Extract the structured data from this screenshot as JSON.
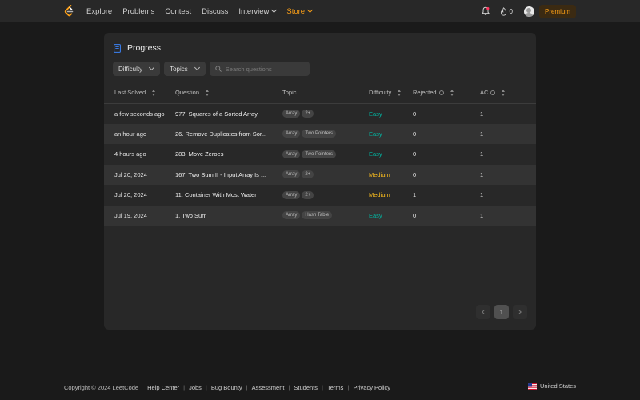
{
  "nav": {
    "items": [
      {
        "label": "Explore",
        "dropdown": false
      },
      {
        "label": "Problems",
        "dropdown": false
      },
      {
        "label": "Contest",
        "dropdown": false
      },
      {
        "label": "Discuss",
        "dropdown": false
      },
      {
        "label": "Interview",
        "dropdown": true
      },
      {
        "label": "Store",
        "dropdown": true,
        "highlight": true
      }
    ],
    "streak_count": "0",
    "premium_label": "Premium",
    "accent_color": "#ffa116"
  },
  "panel": {
    "title": "Progress",
    "filters": {
      "difficulty_label": "Difficulty",
      "topics_label": "Topics",
      "search_placeholder": "Search questions"
    },
    "columns": {
      "last_solved": "Last Solved",
      "question": "Question",
      "topic": "Topic",
      "difficulty": "Difficulty",
      "rejected": "Rejected",
      "ac": "AC"
    },
    "rows": [
      {
        "last_solved": "a few seconds ago",
        "question": "977. Squares of a Sorted Array",
        "tags": [
          "Array",
          "2+"
        ],
        "difficulty": "Easy",
        "rejected": "0",
        "ac": "1"
      },
      {
        "last_solved": "an hour ago",
        "question": "26. Remove Duplicates from Sor...",
        "tags": [
          "Array",
          "Two Pointers"
        ],
        "difficulty": "Easy",
        "rejected": "0",
        "ac": "1"
      },
      {
        "last_solved": "4 hours ago",
        "question": "283. Move Zeroes",
        "tags": [
          "Array",
          "Two Pointers"
        ],
        "difficulty": "Easy",
        "rejected": "0",
        "ac": "1"
      },
      {
        "last_solved": "Jul 20, 2024",
        "question": "167. Two Sum II - Input Array Is ...",
        "tags": [
          "Array",
          "2+"
        ],
        "difficulty": "Medium",
        "rejected": "0",
        "ac": "1"
      },
      {
        "last_solved": "Jul 20, 2024",
        "question": "11. Container With Most Water",
        "tags": [
          "Array",
          "2+"
        ],
        "difficulty": "Medium",
        "rejected": "1",
        "ac": "1"
      },
      {
        "last_solved": "Jul 19, 2024",
        "question": "1. Two Sum",
        "tags": [
          "Array",
          "Hash Table"
        ],
        "difficulty": "Easy",
        "rejected": "0",
        "ac": "1"
      }
    ],
    "pagination": {
      "current_page": "1"
    },
    "colors": {
      "easy": "#00b8a3",
      "medium": "#ffc01e"
    }
  },
  "footer": {
    "copyright": "Copyright © 2024 LeetCode",
    "links": [
      "Help Center",
      "Jobs",
      "Bug Bounty",
      "Assessment",
      "Students",
      "Terms",
      "Privacy Policy"
    ],
    "region": "United States"
  }
}
